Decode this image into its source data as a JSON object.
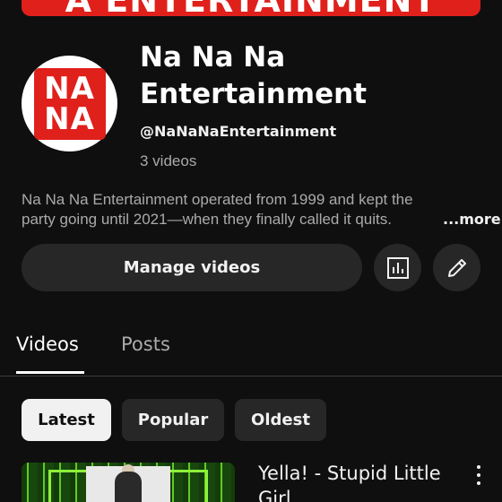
{
  "banner": {
    "text": "A  ENTERTAINMENT"
  },
  "avatar": {
    "line1": "NA",
    "line2": "NA"
  },
  "channel": {
    "name": "Na Na Na Entertainment",
    "handle": "@NaNaNaEntertainment",
    "video_count": "3 videos",
    "description_line1": "Na Na Na Entertainment operated from 1999 and kept the",
    "description_line2": "party going until 2021—when they finally called it quits.",
    "more_label": "...more"
  },
  "actions": {
    "manage_label": "Manage videos",
    "analytics_icon": "analytics-icon",
    "edit_icon": "pencil-icon"
  },
  "tabs": [
    {
      "label": "Videos",
      "selected": true
    },
    {
      "label": "Posts",
      "selected": false
    }
  ],
  "filters": [
    {
      "label": "Latest",
      "selected": true
    },
    {
      "label": "Popular",
      "selected": false
    },
    {
      "label": "Oldest",
      "selected": false
    }
  ],
  "videos": [
    {
      "title": "Yella! - Stupid Little Girl"
    }
  ],
  "colors": {
    "background": "#0f0f0f",
    "brand_red": "#e0201b",
    "chip_selected": "#f1f1f1",
    "surface": "#272727",
    "secondary_text": "#aaaaaa"
  }
}
